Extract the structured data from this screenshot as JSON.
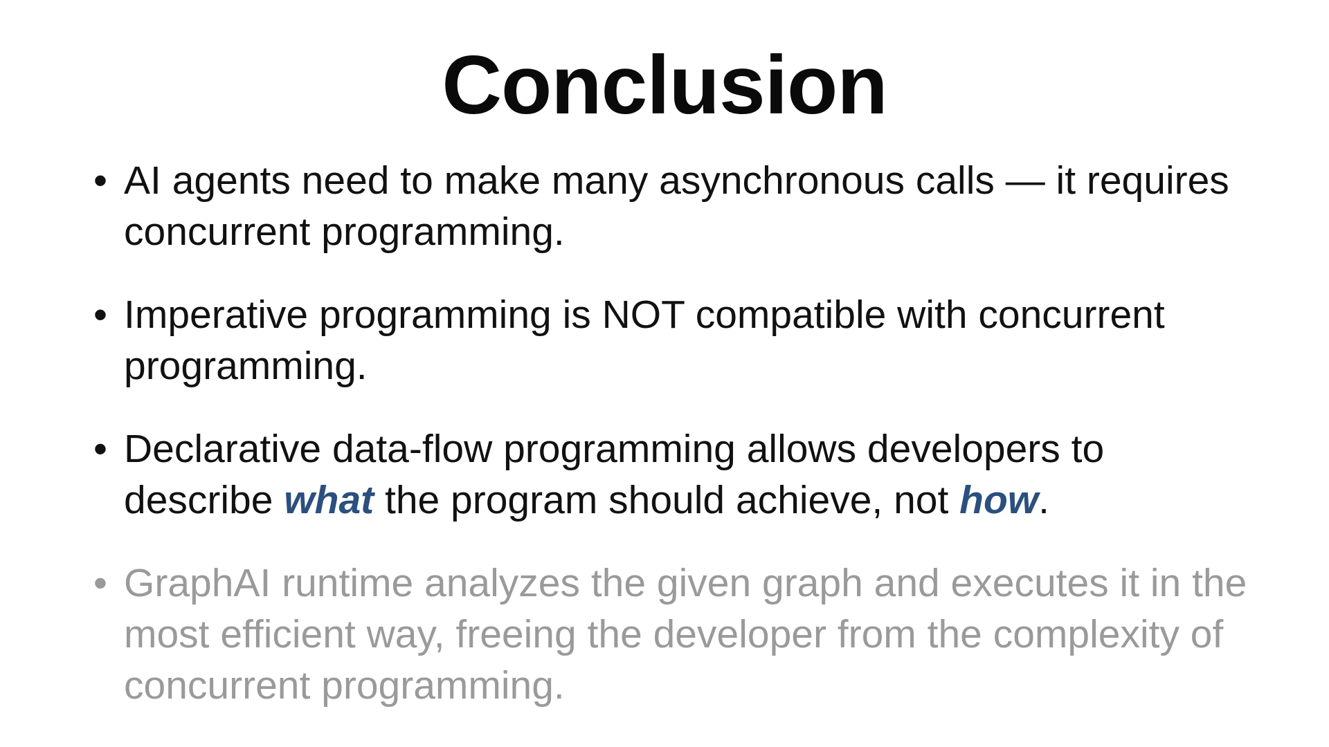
{
  "slide": {
    "title": "Conclusion",
    "bullet_glyph": "•",
    "accent_color": "#2b4f7e",
    "dim_color": "#9a9a9a",
    "bullets": [
      {
        "text": "AI agents need to make many asynchronous calls — it requires concurrent programming."
      },
      {
        "text": "Imperative programming is NOT compatible with concurrent programming."
      },
      {
        "part1": "Declarative data-flow programming allows developers to describe ",
        "em1": "what",
        "part2": " the program should achieve, not ",
        "em2": "how",
        "part3": "."
      },
      {
        "text": "GraphAI runtime analyzes the given graph and executes it in the most efficient way, freeing the developer from the complexity of concurrent programming."
      }
    ]
  }
}
